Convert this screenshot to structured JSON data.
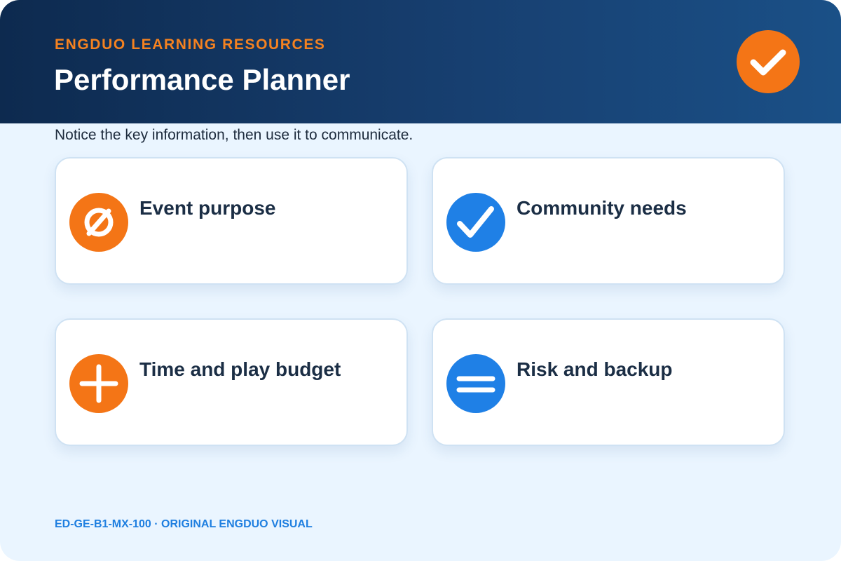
{
  "header": {
    "brand": "ENGDUO LEARNING RESOURCES",
    "title": "Performance Planner",
    "badge_icon": "check-icon"
  },
  "subtitle": "Notice the key information, then use it to communicate.",
  "cards": [
    {
      "label": "Event purpose",
      "icon": "no-entry-icon",
      "color": "#f47516"
    },
    {
      "label": "Community needs",
      "icon": "check-icon",
      "color": "#1f80e6"
    },
    {
      "label": "Time and play budget",
      "icon": "plus-icon",
      "color": "#f47516"
    },
    {
      "label": "Risk and backup",
      "icon": "equals-icon",
      "color": "#1f80e6"
    }
  ],
  "footer": "ED-GE-B1-MX-100 · ORIGINAL ENGDUO VISUAL",
  "colors": {
    "accent_orange": "#f47516",
    "accent_blue": "#1f80e6",
    "header_dark": "#0d2a4f",
    "background": "#eaf5ff"
  }
}
